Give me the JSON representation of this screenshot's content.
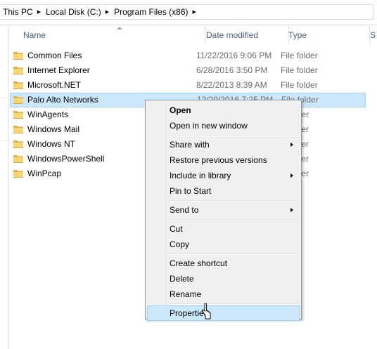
{
  "address": {
    "crumbs": [
      "This PC",
      "Local Disk (C:)",
      "Program Files (x86)"
    ]
  },
  "columns": {
    "name": "Name",
    "date": "Date modified",
    "type": "Type",
    "size": "S"
  },
  "files": [
    {
      "name": "Common Files",
      "date": "11/22/2016 9:06 PM",
      "type": "File folder"
    },
    {
      "name": "Internet Explorer",
      "date": "6/28/2016 3:50 PM",
      "type": "File folder"
    },
    {
      "name": "Microsoft.NET",
      "date": "8/22/2013 8:39 AM",
      "type": "File folder"
    },
    {
      "name": "Palo Alto Networks",
      "date": "12/20/2016 7:25 PM",
      "type": "File folder",
      "selected": true
    },
    {
      "name": "WinAgents",
      "date": "",
      "type": "e folder"
    },
    {
      "name": "Windows Mail",
      "date": "",
      "type": "e folder"
    },
    {
      "name": "Windows NT",
      "date": "",
      "type": "e folder"
    },
    {
      "name": "WindowsPowerShell",
      "date": "",
      "type": "e folder"
    },
    {
      "name": "WinPcap",
      "date": "",
      "type": "e folder"
    }
  ],
  "context_menu": {
    "items": [
      {
        "label": "Open",
        "bold": true
      },
      {
        "label": "Open in new window"
      },
      {
        "sep": true
      },
      {
        "label": "Share with",
        "submenu": true
      },
      {
        "label": "Restore previous versions"
      },
      {
        "label": "Include in library",
        "submenu": true
      },
      {
        "label": "Pin to Start"
      },
      {
        "sep": true
      },
      {
        "label": "Send to",
        "submenu": true
      },
      {
        "sep": true
      },
      {
        "label": "Cut"
      },
      {
        "label": "Copy"
      },
      {
        "sep": true
      },
      {
        "label": "Create shortcut"
      },
      {
        "label": "Delete"
      },
      {
        "label": "Rename"
      },
      {
        "sep": true
      },
      {
        "label": "Properties",
        "hover": true
      }
    ]
  },
  "colors": {
    "selection_fill": "#cce8ff",
    "selection_border": "#99d1ff",
    "folder_yellow": "#f8d775",
    "header_text": "#4c607a",
    "menu_bg": "#f0f0f0"
  },
  "icons": {
    "folder": "folder-icon",
    "breadcrumb_separator": "chevron-right-icon",
    "submenu": "chevron-right-icon",
    "cursor": "mouse-pointer-icon"
  }
}
